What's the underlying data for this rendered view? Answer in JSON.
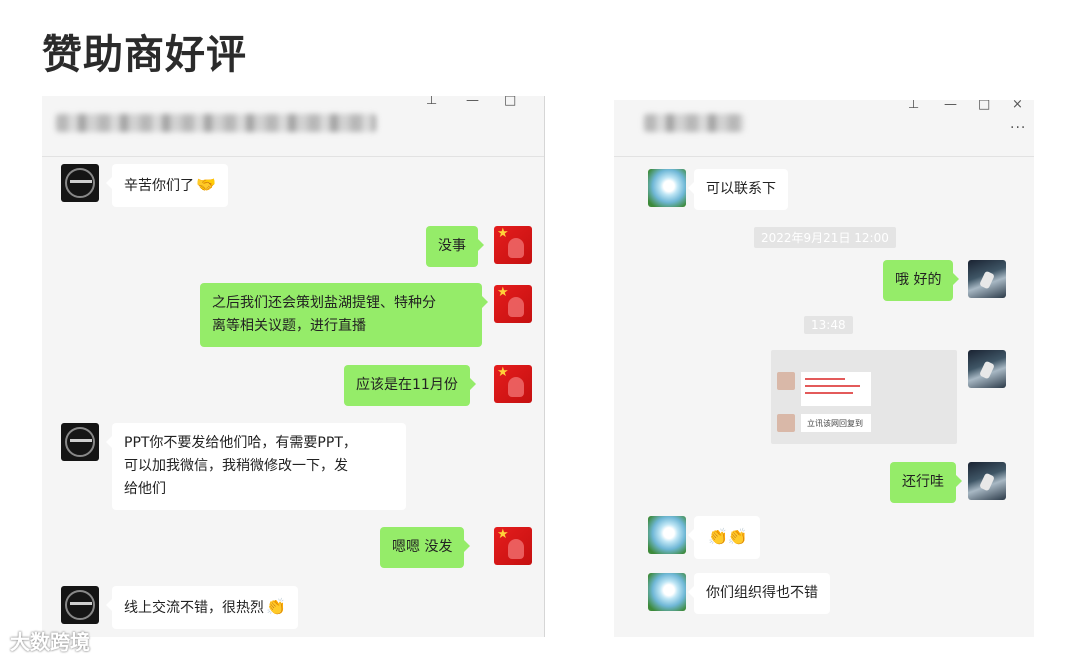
{
  "page_title": "赞助商好评",
  "watermark": "大数跨境",
  "left_chat": {
    "title_controls": [
      "⊥",
      "—",
      "□"
    ],
    "messages": [
      {
        "side": "in",
        "text": "辛苦你们了",
        "emoji": "🤝"
      },
      {
        "side": "out",
        "text": "没事"
      },
      {
        "side": "out",
        "lines": [
          "之后我们还会策划盐湖提锂、特种分",
          "离等相关议题，进行直播"
        ]
      },
      {
        "side": "out",
        "text": "应该是在11月份"
      },
      {
        "side": "in",
        "lines": [
          "PPT你不要发给他们哈，有需要PPT，",
          "可以加我微信，我稍微修改一下，发",
          "给他们"
        ]
      },
      {
        "side": "out",
        "text": "嗯嗯   没发"
      },
      {
        "side": "in",
        "text": "线上交流不错，很热烈",
        "emoji": "👏"
      }
    ]
  },
  "right_chat": {
    "title_controls": [
      "⊥",
      "—",
      "□",
      "×"
    ],
    "more_icon": "···",
    "messages": [
      {
        "side": "in",
        "text": "可以联系下"
      },
      {
        "type": "timestamp",
        "text": "2022年9月21日 12:00"
      },
      {
        "side": "out",
        "text": "哦  好的"
      },
      {
        "type": "timestamp",
        "text": "13:48"
      },
      {
        "side": "out",
        "type": "image",
        "caption": "立讯该网回复到"
      },
      {
        "side": "out",
        "text": "还行哇"
      },
      {
        "side": "in",
        "emoji": "👏👏"
      },
      {
        "side": "in",
        "text": "你们组织得也不错"
      }
    ]
  }
}
